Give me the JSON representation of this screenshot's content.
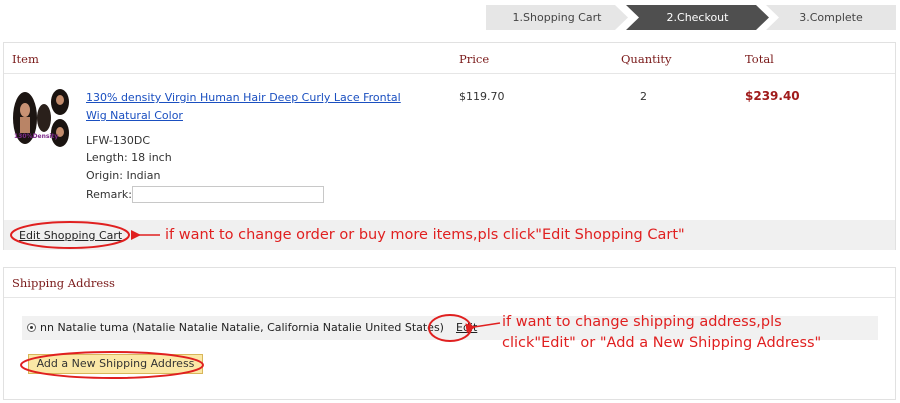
{
  "steps": [
    "1.Shopping Cart",
    "2.Checkout",
    "3.Complete"
  ],
  "cart": {
    "headers": {
      "item": "Item",
      "price": "Price",
      "quantity": "Quantity",
      "total": "Total"
    },
    "product": {
      "title": "130% density Virgin Human Hair Deep Curly Lace Frontal Wig Natural Color",
      "sku": "LFW-130DC",
      "length": "Length: 18 inch",
      "origin": "Origin: Indian",
      "remark_label": "Remark:",
      "remark_value": "",
      "thumb_badge": "130%Density",
      "price": "$119.70",
      "quantity": "2",
      "total": "$239.40"
    },
    "edit_cart_label": "Edit Shopping Cart"
  },
  "shipping": {
    "header": "Shipping Address",
    "address": "nn Natalie tuma (Natalie Natalie Natalie, California Natalie United States)",
    "edit_label": "Edit",
    "add_label": "Add a New Shipping Address"
  },
  "annotations": {
    "cart_note": "if want to change order or buy more items,pls click\"Edit Shopping Cart\"",
    "address_note_1": "if want to change shipping address,pls",
    "address_note_2": "click\"Edit\" or \"Add a New Shipping Address\"",
    "color": "#e02020"
  },
  "colors": {
    "step_active": "#4f4f4f",
    "step_inactive": "#e6e6e6",
    "header_text": "#7a1a1a",
    "total_text": "#a01b1b",
    "link": "#1a4fc0"
  }
}
